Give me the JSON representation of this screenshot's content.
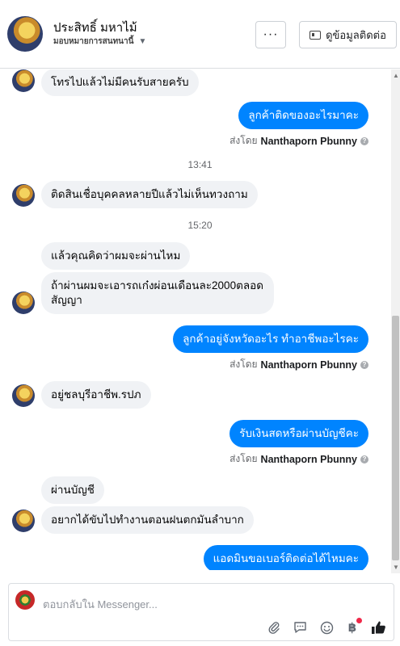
{
  "header": {
    "contact_name": "ประสิทธิ์ มหาไม้",
    "contact_status": "มอบหมายการสนทนานี้",
    "more_label": "···",
    "info_label": "ดูข้อมูลติดต่อ"
  },
  "messages": [
    {
      "dir": "in",
      "text": "โทรไปแล้วไม่มีคนรับสายครับ"
    },
    {
      "dir": "out",
      "text": "ลูกค้าติดของอะไรมาคะ"
    },
    {
      "sent_by_label": "ส่งโดย",
      "sent_by_name": "Nanthaporn Pbunny"
    },
    {
      "time": "13:41"
    },
    {
      "dir": "in",
      "text": "ติดสินเชื่อบุคคลหลายปีแล้วไม่เห็นทวงถาม"
    },
    {
      "time": "15:20"
    },
    {
      "dir": "in",
      "text": "แล้วคุณคิดว่าผมจะผ่านไหม"
    },
    {
      "dir": "in",
      "text": "ถ้าผ่านผมจะเอารถเก๋งผ่อนเดือนละ2000ตลอดสัญญา"
    },
    {
      "dir": "out",
      "text": "ลูกค้าอยู่จังหวัดอะไร ทำอาชีพอะไรคะ"
    },
    {
      "sent_by_label": "ส่งโดย",
      "sent_by_name": "Nanthaporn Pbunny"
    },
    {
      "dir": "in",
      "text": "อยู่ชลบุรีอาชีพ.รปภ"
    },
    {
      "dir": "out",
      "text": "รับเงินสดหรือผ่านบัญชีคะ"
    },
    {
      "sent_by_label": "ส่งโดย",
      "sent_by_name": "Nanthaporn Pbunny"
    },
    {
      "dir": "in",
      "text": "ผ่านบัญชี"
    },
    {
      "dir": "in",
      "text": "อยากได้ขับไปทำงานตอนฝนตกมันลำบาก"
    },
    {
      "dir": "out",
      "text": "แอดมินขอเบอร์ติดต่อได้ไหมคะ"
    }
  ],
  "composer": {
    "placeholder": "ตอบกลับใน Messenger..."
  },
  "icons": {
    "more": "ellipsis-icon",
    "info": "contact-card-icon",
    "attach": "paperclip-icon",
    "saved_replies": "chat-bubble-icon",
    "emoji": "smiley-icon",
    "payment": "baht-icon",
    "like": "thumbs-up-icon"
  },
  "colors": {
    "outgoing_bubble": "#0084ff",
    "incoming_bubble": "#f0f2f5",
    "badge": "#f02849"
  }
}
